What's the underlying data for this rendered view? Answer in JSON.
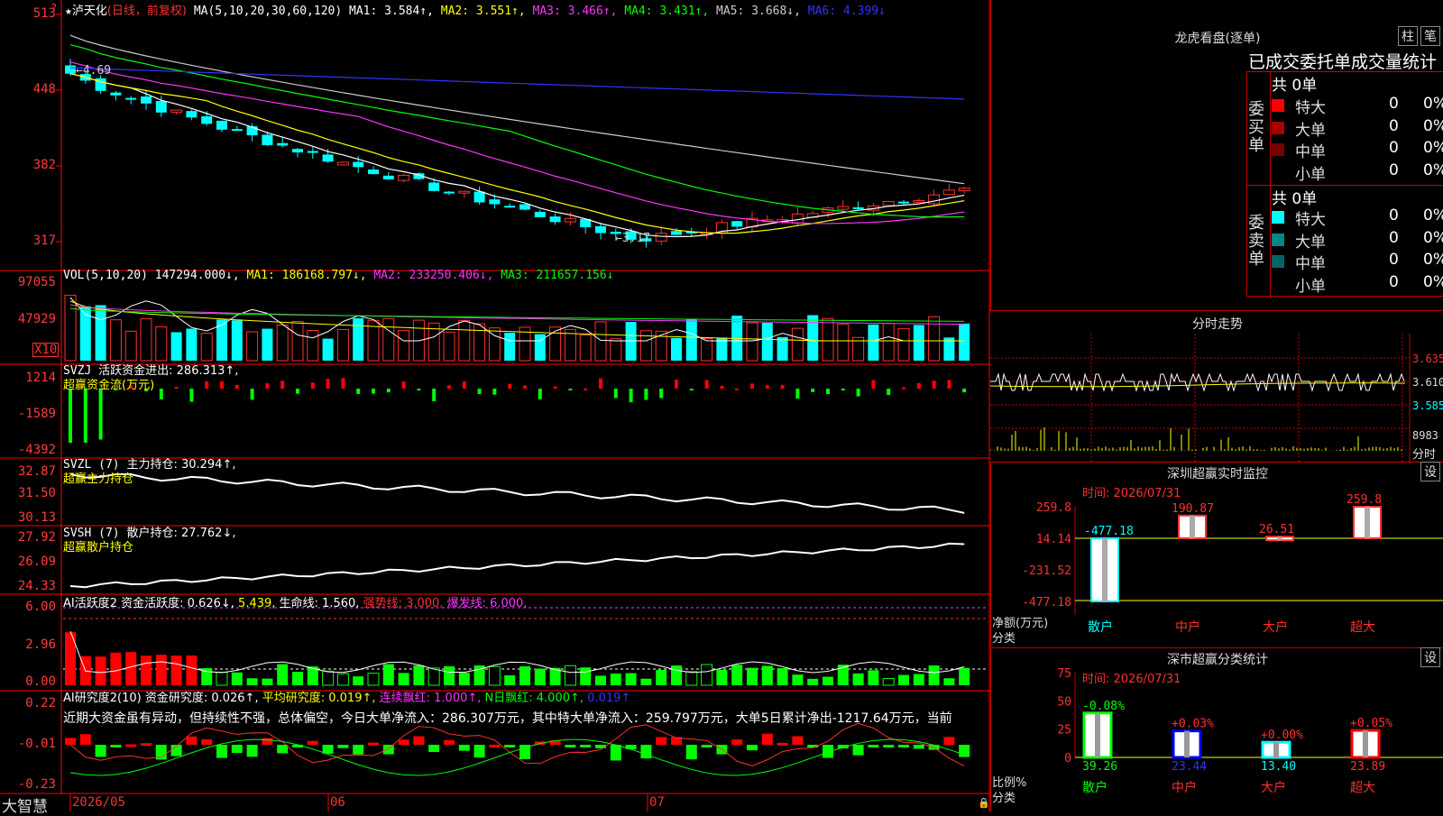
{
  "app": {
    "brand": "大智慧"
  },
  "kline": {
    "stock_name": "泸天化",
    "mode": "(日线，前复权)",
    "ma_header": "MA(5,10,20,30,60,120)",
    "ma": [
      {
        "label": "MA1: 3.584↑,",
        "color": "#ffffff"
      },
      {
        "label": "MA2: 3.551↑,",
        "color": "#ffff00"
      },
      {
        "label": "MA3: 3.466↑,",
        "color": "#ff33ff"
      },
      {
        "label": "MA4: 3.431↑,",
        "color": "#00ff00"
      },
      {
        "label": "MA5: 3.668↓,",
        "color": "#cccccc"
      },
      {
        "label": "MA6: 4.399↓",
        "color": "#3333ff"
      }
    ],
    "y_labels": [
      "513",
      "448",
      "382",
      "317"
    ],
    "high_label": "←4.69",
    "low_label": "←3.17",
    "colors": {
      "up": "#ff3030",
      "down": "#00ffff"
    }
  },
  "volume": {
    "header": "VOL(5,10,20)",
    "val": "147294.000↓,",
    "ma1": "MA1: 186168.797↓,",
    "ma2": "MA2: 233250.406↓,",
    "ma3": "MA3: 211657.156↓",
    "y_labels": [
      "97055",
      "47929"
    ],
    "unit": "X10"
  },
  "svzj": {
    "header": "SVZJ",
    "label": "活跃资金进出: 286.313↑,",
    "sub": "超赢资金流(万元)",
    "y_labels": [
      "1214",
      "-1589",
      "-4392"
    ]
  },
  "svzl": {
    "header": "SVZL (7)",
    "label": "主力持仓: 30.294↑,",
    "sub": "超赢主力持仓",
    "y_labels": [
      "32.87",
      "31.50",
      "30.13"
    ]
  },
  "svsh": {
    "header": "SVSH (7)",
    "label": "散户持仓: 27.762↓,",
    "sub": "超赢散户持仓",
    "y_labels": [
      "27.92",
      "26.09",
      "24.33"
    ]
  },
  "ai_active": {
    "header": "AI活跃度2",
    "a": "资金活跃度: 0.626↓,",
    "b": "5.439,",
    "c": "生命线: 1.560,",
    "d": "强势线: 3.000,",
    "e": "爆发线: 6.000,",
    "y_labels": [
      "6.00",
      "2.96",
      "0.00"
    ]
  },
  "ai_research": {
    "header": "AI研究度2(10)",
    "a": "资金研究度: 0.026↑,",
    "b": "平均研究度: 0.019↑,",
    "c": "连续飘红: 1.000↑,",
    "d": "N日飘红: 4.000↑,",
    "e": "0.019↑",
    "comment": "近期大资金虽有异动，但持续性不强，总体偏空，今日大单净流入：286.307万元，其中特大单净流入：259.797万元，大单5日累计净出-1217.64万元，当前",
    "y_labels": [
      "0.22",
      "-0.01",
      "-0.23"
    ]
  },
  "xaxis": {
    "labels": [
      "2026/05",
      "06",
      "07"
    ]
  },
  "longhu": {
    "title": "龙虎看盘(逐单)",
    "btn1": "柱",
    "btn2": "笔",
    "subtitle": "已成交委托单成交量统计",
    "buy": {
      "side": "委买单",
      "total": "共 0单",
      "rows": [
        {
          "name": "特大",
          "v": "0",
          "p": "0%",
          "color": "#ff0000"
        },
        {
          "name": "大单",
          "v": "0",
          "p": "0%",
          "color": "#aa0000"
        },
        {
          "name": "中单",
          "v": "0",
          "p": "0%",
          "color": "#770000"
        },
        {
          "name": "小单",
          "v": "0",
          "p": "0%",
          "color": "#000000"
        }
      ]
    },
    "sell": {
      "side": "委卖单",
      "total": "共 0单",
      "rows": [
        {
          "name": "特大",
          "v": "0",
          "p": "0%",
          "color": "#00ffff"
        },
        {
          "name": "大单",
          "v": "0",
          "p": "0%",
          "color": "#008888"
        },
        {
          "name": "中单",
          "v": "0",
          "p": "0%",
          "color": "#006666"
        },
        {
          "name": "小单",
          "v": "0",
          "p": "0%",
          "color": "#000000"
        }
      ]
    }
  },
  "fenshi": {
    "title": "分时走势",
    "y_labels": [
      "3.635",
      "3.610",
      "3.585"
    ],
    "vol_label": "8983",
    "unit": "分时"
  },
  "sz_monitor": {
    "title": "深圳超赢实时监控",
    "btn": "设",
    "time": "时间: 2026/07/31",
    "y_labels": [
      "259.8",
      "14.14",
      "-231.52",
      "-477.18"
    ],
    "bar_labels": [
      "-477.18",
      "190.87",
      "26.51",
      "259.8"
    ],
    "net_label": "净额(万元)",
    "cat_label": "分类",
    "cats": [
      "散户",
      "中户",
      "大户",
      "超大"
    ],
    "chart_data": {
      "type": "bar",
      "categories": [
        "散户",
        "中户",
        "大户",
        "超大"
      ],
      "values": [
        -477.18,
        190.87,
        26.51,
        259.8
      ],
      "ylabel": "净额(万元)",
      "ylim": [
        -477.18,
        259.8
      ]
    }
  },
  "sz_class": {
    "title": "深市超赢分类统计",
    "btn": "设",
    "time": "时间: 2026/07/31",
    "y_labels": [
      "75",
      "50",
      "25",
      "0"
    ],
    "pct_labels": [
      "-0.08%",
      "+0.03%",
      "+0.00%",
      "+0.05%"
    ],
    "val_labels": [
      "39.26",
      "23.44",
      "13.40",
      "23.89"
    ],
    "ratio_label": "比例%",
    "cat_label": "分类",
    "cats": [
      "散户",
      "中户",
      "大户",
      "超大"
    ],
    "chart_data": {
      "type": "bar",
      "categories": [
        "散户",
        "中户",
        "大户",
        "超大"
      ],
      "values": [
        39.26,
        23.44,
        13.4,
        23.89
      ],
      "ylabel": "比例%",
      "ylim": [
        0,
        75
      ]
    }
  }
}
